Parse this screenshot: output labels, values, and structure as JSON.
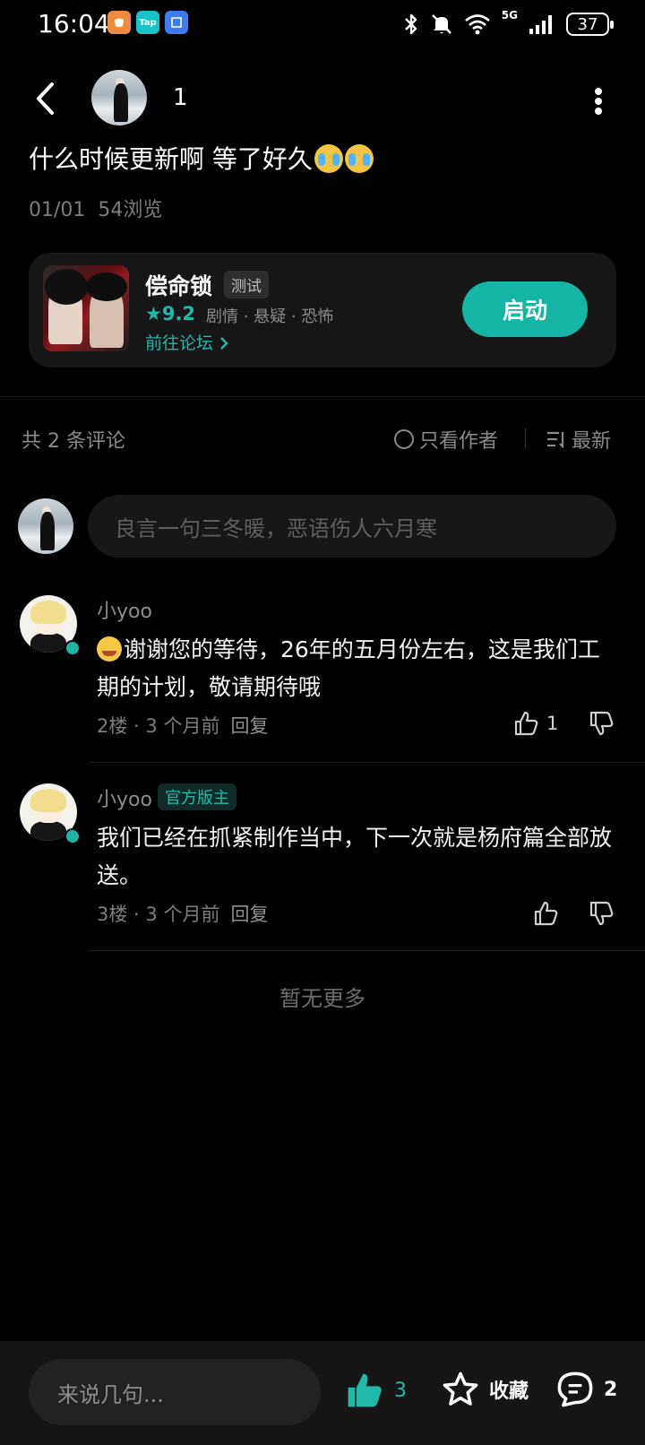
{
  "status_bar": {
    "time": "16:04",
    "apps": [
      {
        "icon": "orange-app-icon",
        "label": "",
        "color": "#f08a3c"
      },
      {
        "icon": "taptap-icon",
        "label": "Tap",
        "color": "#18c3c8"
      },
      {
        "icon": "blue-app-icon",
        "label": "",
        "color": "#3d7bf2"
      }
    ],
    "network": "5G",
    "battery": "37"
  },
  "header": {
    "author_name": "1",
    "back_icon": "chevron-left-icon",
    "more_icon": "more-vertical-icon"
  },
  "post": {
    "title": "什么时候更新啊 等了好久",
    "title_emoji": "loudly-crying-emoji",
    "date": "01/01",
    "views": "54浏览"
  },
  "game_card": {
    "name": "偿命锁",
    "tag": "测试",
    "rating": "9.2",
    "genres": "剧情 · 悬疑 · 恐怖",
    "forum_link": "前往论坛",
    "launch_label": "启动",
    "accent": "#14b5a5"
  },
  "comments_header": {
    "count_text": "共 2 条评论",
    "author_only": "只看作者",
    "sort_label": "最新"
  },
  "comment_input": {
    "placeholder": "良言一句三冬暖，恶语伤人六月寒"
  },
  "comments": [
    {
      "name": "小yoo",
      "badge": "",
      "text": "谢谢您的等待，26年的五月份左右，这是我们工期的计划，敬请期待哦",
      "floor": "2楼",
      "time": "3 个月前",
      "reply": "回复",
      "likes": "1"
    },
    {
      "name": "小yoo",
      "badge": "官方版主",
      "text": "我们已经在抓紧制作当中，下一次就是杨府篇全部放送。",
      "floor": "3楼",
      "time": "3 个月前",
      "reply": "回复",
      "likes": ""
    }
  ],
  "no_more": "暂无更多",
  "bottom_bar": {
    "input_placeholder": "来说几句...",
    "like_count": "3",
    "fav_label": "收藏",
    "comment_count": "2"
  }
}
